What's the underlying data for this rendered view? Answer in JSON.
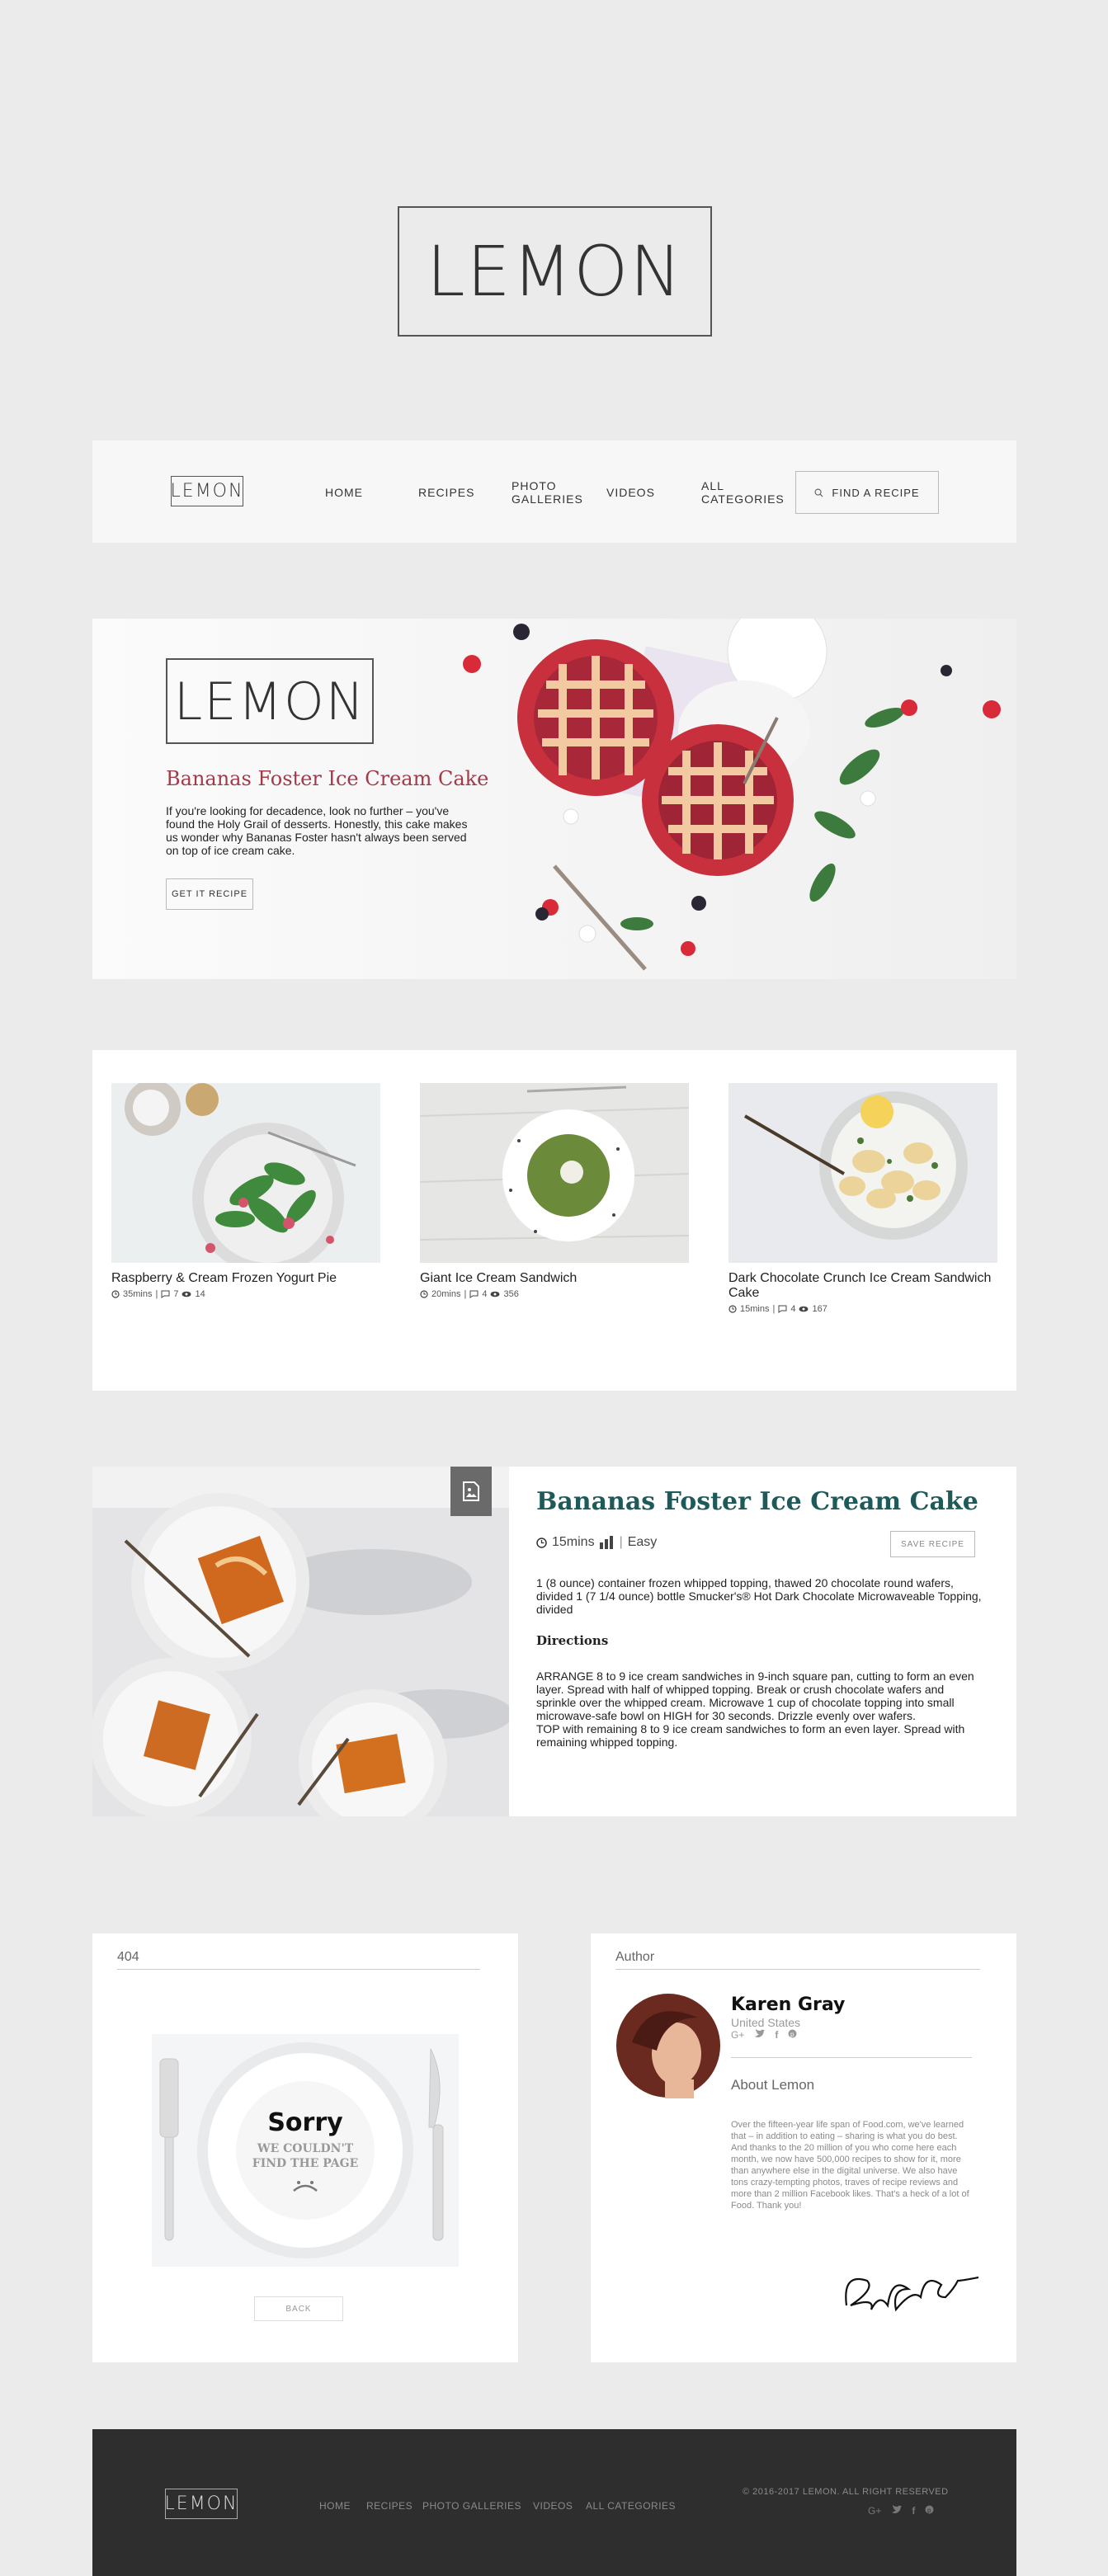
{
  "brand": {
    "logo": "LEMON"
  },
  "nav": {
    "items": [
      "HOME",
      "RECIPES",
      "PHOTO GALLERIES",
      "VIDEOS",
      "ALL CATEGORIES"
    ],
    "photo_line1": "PHOTO",
    "photo_line2": "GALLERIES",
    "all_line1": "ALL",
    "all_line2": "CATEGORIES",
    "search_label": "FIND A RECIPE"
  },
  "banner": {
    "title": "Bananas Foster Ice Cream Cake",
    "text": "If you're looking for decadence, look no further – you've found the Holy Grail of desserts. Honestly, this cake makes us wonder why Bananas Foster hasn't always been served on top of ice cream cake.",
    "button": "GET IT RECIPE"
  },
  "cards": [
    {
      "title": "Raspberry & Cream Frozen Yogurt Pie",
      "time": "35mins",
      "comments": "7",
      "views": "14"
    },
    {
      "title": "Giant Ice Cream Sandwich",
      "time": "20mins",
      "comments": "4",
      "views": "356"
    },
    {
      "title": "Dark Chocolate Crunch Ice Cream Sandwich Cake",
      "time": "15mins",
      "comments": "4",
      "views": "167"
    }
  ],
  "recipe": {
    "title": "Bananas Foster Ice Cream Cake",
    "time": "15mins",
    "difficulty": "Easy",
    "save": "SAVE RECIPE",
    "ingredients": "1 (8 ounce) container frozen whipped topping, thawed 20 chocolate round wafers, divided 1 (7 1/4 ounce) bottle Smucker's® Hot Dark Chocolate Microwaveable Topping, divided",
    "directions_heading": "Directions",
    "directions": "ARRANGE 8 to 9 ice cream sandwiches in 9-inch square pan, cutting to form an even layer. Spread with half of whipped topping. Break or crush chocolate wafers and sprinkle over the whipped cream. Microwave 1 cup of chocolate topping into small microwave-safe bowl on HIGH for 30 seconds. Drizzle evenly over wafers.",
    "directions2": "TOP with remaining 8 to 9 ice cream sandwiches to form an even layer. Spread with remaining whipped topping."
  },
  "error_page": {
    "label": "404",
    "sorry": "Sorry",
    "line1": "WE COULDN'T",
    "line2": "FIND THE PAGE",
    "back": "BACK"
  },
  "author": {
    "label": "Author",
    "name": "Karen Gray",
    "country": "United States",
    "about_heading": "About Lemon",
    "about": "Over the fifteen-year life span of Food.com, we've learned that – in addition to eating – sharing is what you do best. And thanks to the 20 million of you who come here each month, we now have 500,000 recipes to show for it, more than anywhere else in the digital universe. We also have tons crazy-tempting photos, traves of recipe reviews and more than 2 million Facebook likes. That's a heck of a lot of Food. Thank you!"
  },
  "footer": {
    "links": [
      "HOME",
      "RECIPES",
      "PHOTO GALLERIES",
      "VIDEOS",
      "ALL CATEGORIES"
    ],
    "copyright": "© 2016-2017 LEMON. ALL RIGHT RESERVED"
  },
  "colors": {
    "page_bg": "#ebebeb",
    "banner_title": "#a13a4a",
    "recipe_title": "#1f5a5a",
    "footer_bg": "#2e2e2e"
  }
}
